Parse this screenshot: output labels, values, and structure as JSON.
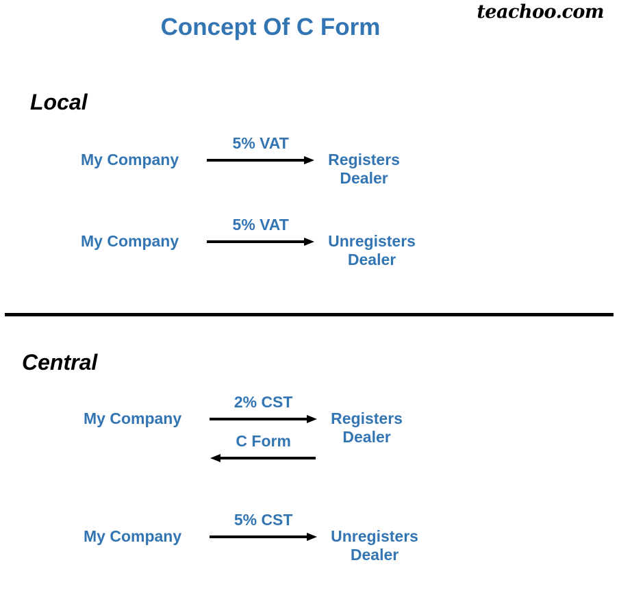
{
  "watermark": "teachoo.com",
  "title": "Concept Of C Form",
  "sections": [
    {
      "heading": "Local",
      "flows": [
        {
          "source": "My Company",
          "target_line1": "Registers",
          "target_line2": "Dealer",
          "arrows": [
            {
              "label": "5% VAT",
              "direction": "right"
            }
          ]
        },
        {
          "source": "My Company",
          "target_line1": "Unregisters",
          "target_line2": "Dealer",
          "arrows": [
            {
              "label": "5% VAT",
              "direction": "right"
            }
          ]
        }
      ]
    },
    {
      "heading": "Central",
      "flows": [
        {
          "source": "My Company",
          "target_line1": "Registers",
          "target_line2": "Dealer",
          "arrows": [
            {
              "label": "2% CST",
              "direction": "right"
            },
            {
              "label": "C Form",
              "direction": "left"
            }
          ]
        },
        {
          "source": "My Company",
          "target_line1": "Unregisters",
          "target_line2": "Dealer",
          "arrows": [
            {
              "label": "5% CST",
              "direction": "right"
            }
          ]
        }
      ]
    }
  ],
  "colors": {
    "accent_blue": "#3375B3",
    "text_black": "#000000",
    "background": "#ffffff"
  }
}
